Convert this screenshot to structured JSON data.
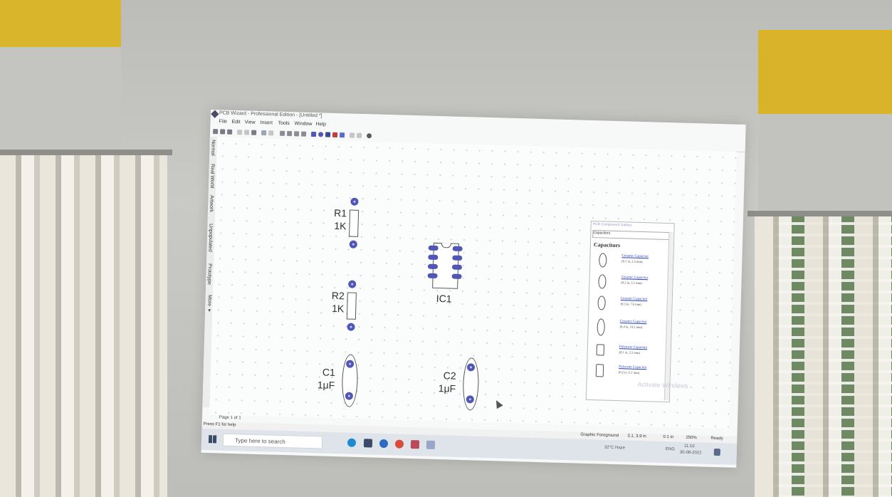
{
  "window": {
    "title": "PCB Wizard - Professional Edition - [Untitled *]"
  },
  "menu": [
    "File",
    "Edit",
    "View",
    "Insert",
    "Tools",
    "Window",
    "Help"
  ],
  "side_tabs": [
    "Normal",
    "Real World",
    "Artwork",
    "Unpopulated",
    "Prototype",
    "More ▾"
  ],
  "components": {
    "r1": {
      "name": "R1",
      "value": "1K"
    },
    "r2": {
      "name": "R2",
      "value": "1K"
    },
    "ic1": {
      "name": "IC1"
    },
    "c1": {
      "name": "C1",
      "value": "1μF"
    },
    "c2": {
      "name": "C2",
      "value": "1μF"
    }
  },
  "gallery": {
    "title": "PCB Component Gallery",
    "category": "Capacitors",
    "heading": "Capacitors",
    "items": [
      {
        "name": "Ceramic Capacitor",
        "spec": "(0.1 in, 2.5 mm)"
      },
      {
        "name": "Ceramic Capacitor",
        "spec": "(0.2 in, 5.1 mm)"
      },
      {
        "name": "Ceramic Capacitor",
        "spec": "(0.3 in, 7.6 mm)"
      },
      {
        "name": "Ceramic Capacitor",
        "spec": "(0.4 in, 10.2 mm)"
      },
      {
        "name": "Polyester Capacitor",
        "spec": "(0.1 in, 2.5 mm)"
      },
      {
        "name": "Polyester Capacitor",
        "spec": "(0.2 in, 5.1 mm)"
      }
    ]
  },
  "page_nav": "Page 1 of 1",
  "status": {
    "help": "Press F1 for help",
    "layer": "Graphic Foreground",
    "coords": "3.1, 3.9 in",
    "grid": "0.1 in",
    "zoom": "250%",
    "state": "Ready"
  },
  "activate": "Activate Windows",
  "taskbar": {
    "search_placeholder": "Type here to search",
    "weather": "32°C Haze",
    "lang": "ENG",
    "time": "11:10",
    "date": "30-08-2022"
  }
}
